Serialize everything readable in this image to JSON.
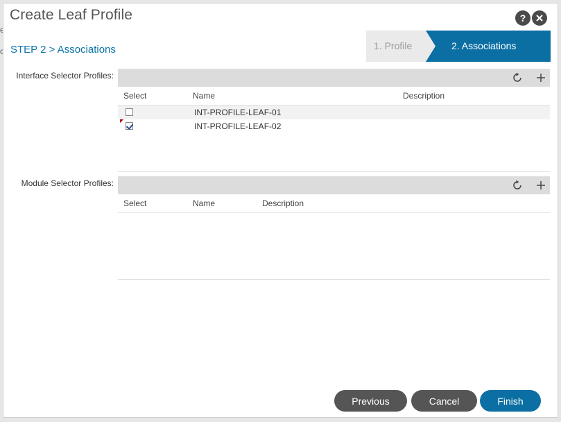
{
  "dialog": {
    "title": "Create Leaf Profile",
    "help_icon": "help-icon",
    "close_icon": "close-icon",
    "step_label": "STEP 2 > Associations"
  },
  "wizard": {
    "steps": [
      {
        "label": "1. Profile",
        "active": false
      },
      {
        "label": "2. Associations",
        "active": true
      }
    ]
  },
  "interface_selector": {
    "label": "Interface Selector Profiles:",
    "columns": {
      "select": "Select",
      "name": "Name",
      "description": "Description"
    },
    "rows": [
      {
        "name": "INT-PROFILE-LEAF-01",
        "checked": false
      },
      {
        "name": "INT-PROFILE-LEAF-02",
        "checked": true
      }
    ]
  },
  "module_selector": {
    "label": "Module Selector Profiles:",
    "columns": {
      "select": "Select",
      "name": "Name",
      "description": "Description"
    },
    "rows": []
  },
  "buttons": {
    "previous": "Previous",
    "cancel": "Cancel",
    "finish": "Finish"
  },
  "background": {
    "edge_chars": [
      "e",
      "o"
    ]
  },
  "colors": {
    "accent": "#0b6fa3",
    "button_dark": "#555555"
  }
}
